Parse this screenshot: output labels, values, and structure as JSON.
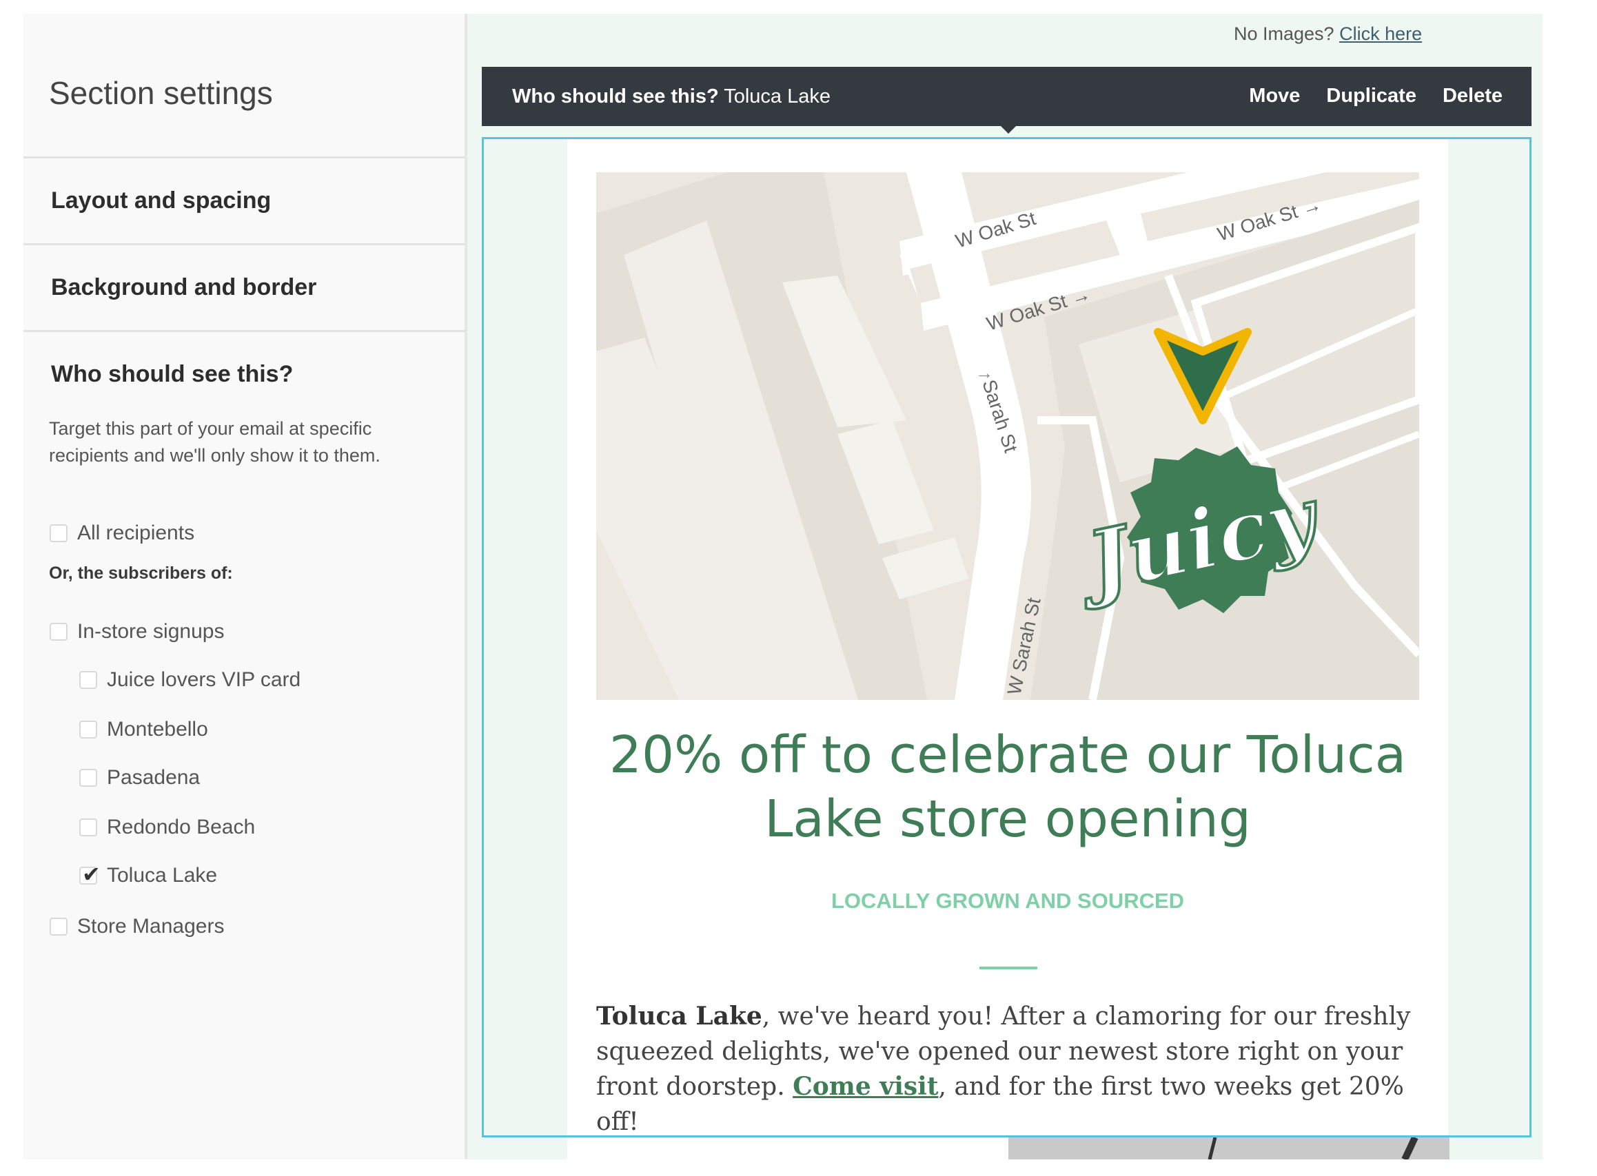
{
  "sidebar": {
    "title": "Section settings",
    "sections": {
      "layout": "Layout and spacing",
      "background": "Background and border",
      "who": "Who should see this?"
    },
    "who_description": "Target this part of your email at specific recipients and we'll only show it to them.",
    "all_recipients": {
      "label": "All recipients",
      "checked": false
    },
    "subscribers_heading": "Or, the subscribers of:",
    "lists": [
      {
        "label": "In-store signups",
        "checked": false,
        "indent": 0
      },
      {
        "label": "Juice lovers VIP card",
        "checked": false,
        "indent": 1
      },
      {
        "label": "Montebello",
        "checked": false,
        "indent": 1
      },
      {
        "label": "Pasadena",
        "checked": false,
        "indent": 1
      },
      {
        "label": "Redondo Beach",
        "checked": false,
        "indent": 1
      },
      {
        "label": "Toluca Lake",
        "checked": true,
        "indent": 1
      },
      {
        "label": "Store Managers",
        "checked": false,
        "indent": 0
      }
    ]
  },
  "canvas": {
    "no_images_text": "No Images?",
    "no_images_link": "Click here",
    "toolbar": {
      "who_label": "Who should see this?",
      "who_value": "Toluca Lake",
      "move": "Move",
      "duplicate": "Duplicate",
      "delete": "Delete"
    },
    "map": {
      "streets": [
        "W Oak St",
        "W Oak St",
        "W Oak St",
        "Sarah St",
        "W Sarah St"
      ],
      "logo_text": "Juicy",
      "pin_color": "#2f6e4b",
      "pin_outline": "#f2b600"
    },
    "headline": "20% off to celebrate our Toluca Lake store opening",
    "tagline": "LOCALLY GROWN AND SOURCED",
    "body": {
      "lead": "Toluca Lake",
      "text1": ", we've heard you! After a clamoring for our freshly squeezed delights, we've opened our newest store right on your front doorstep. ",
      "link": "Come visit",
      "text2": ", and for the first two weeks get 20% off!"
    }
  },
  "colors": {
    "brand_green": "#3e7d55",
    "accent_mint": "#7fd0a7",
    "toolbar_dark": "#343a40",
    "selection_blue": "#5bc0de",
    "canvas_bg": "#eef7f2"
  }
}
